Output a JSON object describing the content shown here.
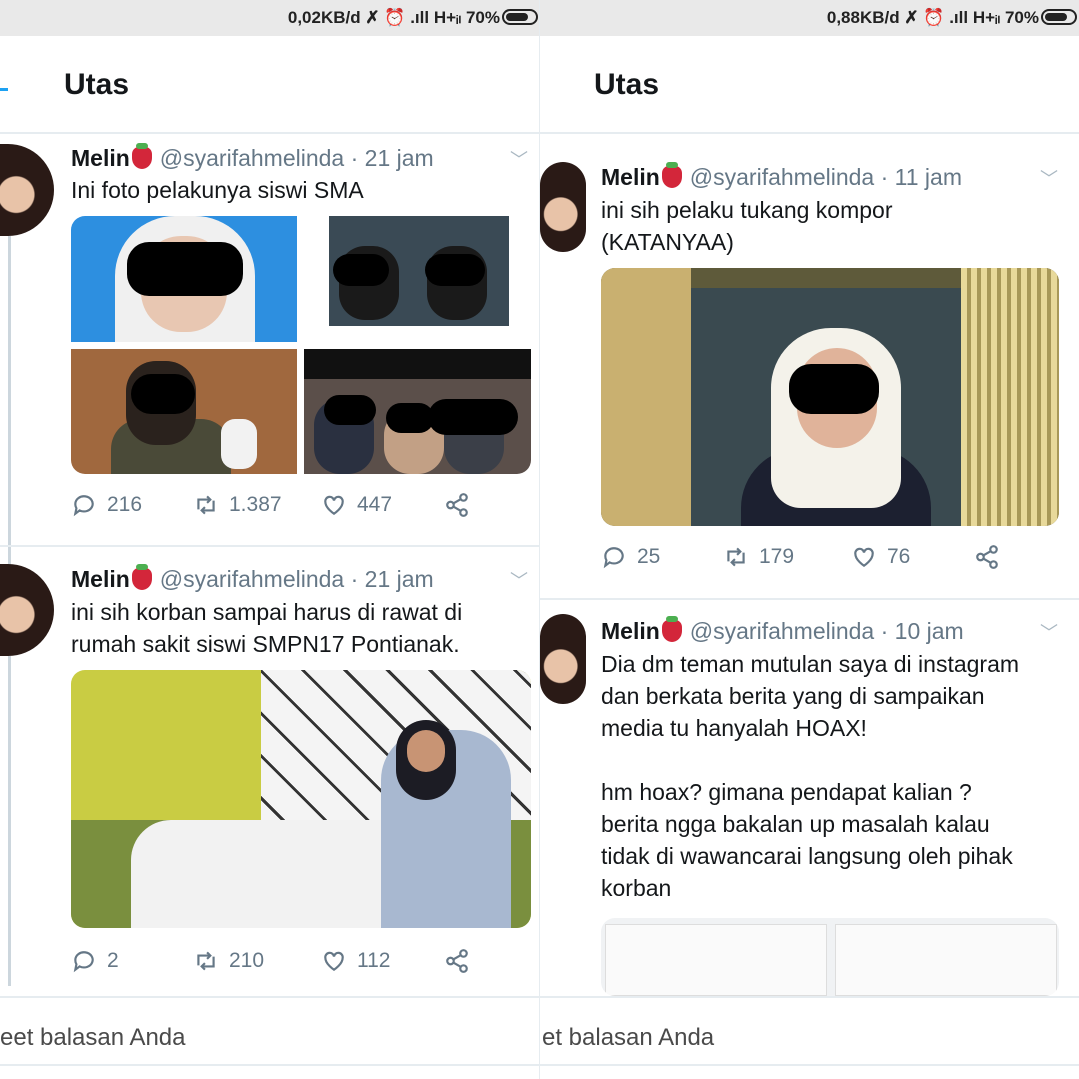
{
  "left": {
    "status": {
      "text": "0,02KB/d ✗ ⏰ .ıll H+ᵢₗ 70%"
    },
    "header": {
      "title": "Utas"
    },
    "tweets": [
      {
        "name": "Melin",
        "handle": "@syarifahmelinda · 21 jam",
        "text": "Ini foto pelakunya siswi SMA",
        "replies": "216",
        "retweets": "1.387",
        "likes": "447"
      },
      {
        "name": "Melin",
        "handle": "@syarifahmelinda · 21 jam",
        "text": "ini sih korban sampai harus di rawat di\nrumah sakit siswi SMPN17 Pontianak.",
        "replies": "2",
        "retweets": "210",
        "likes": "112"
      }
    ],
    "composer": {
      "placeholder": "eet balasan Anda"
    }
  },
  "right": {
    "status": {
      "text": "0,88KB/d ✗ ⏰ .ıll H+ᵢₗ 70%"
    },
    "header": {
      "title": "Utas"
    },
    "tweets": [
      {
        "name": "Melin",
        "handle": "@syarifahmelinda · 11 jam",
        "text": "ini sih pelaku tukang kompor\n(KATANYAA)",
        "replies": "25",
        "retweets": "179",
        "likes": "76"
      },
      {
        "name": "Melin",
        "handle": "@syarifahmelinda · 10 jam",
        "text": "Dia dm teman mutulan saya di instagram\ndan berkata berita yang di sampaikan\nmedia tu hanyalah HOAX!\n\nhm hoax? gimana pendapat kalian ?\nberita ngga bakalan up masalah kalau\ntidak di wawancarai langsung oleh pihak\nkorban"
      }
    ],
    "composer": {
      "placeholder": "et balasan Anda"
    }
  },
  "colors": {
    "accent": "#1da1f2",
    "muted": "#657786",
    "divider": "#e6ecf0"
  }
}
